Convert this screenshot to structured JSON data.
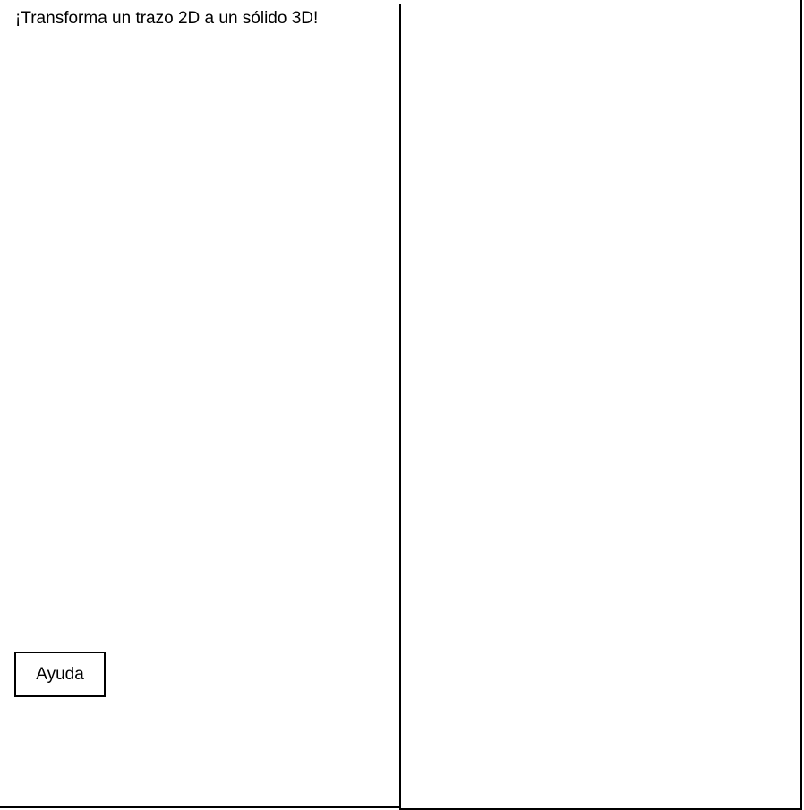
{
  "app": {
    "title": "¡Transforma un trazo 2D a un sólido 3D!"
  },
  "controls": {
    "help_label": "Ayuda"
  },
  "colors": {
    "background": "#ffffff",
    "border": "#000000",
    "text": "#000000"
  }
}
